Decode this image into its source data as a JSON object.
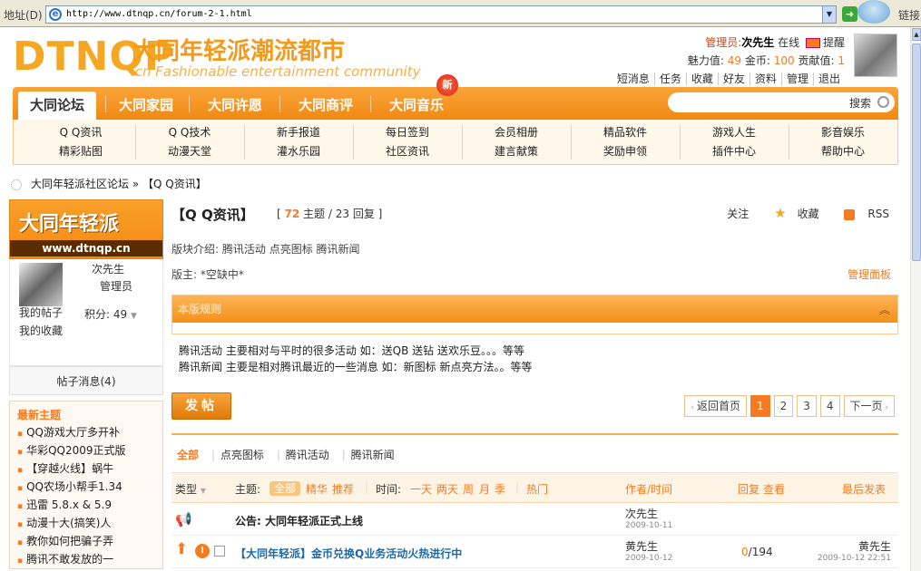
{
  "browser": {
    "address_label": "地址(D)",
    "url": "http://www.dtnqp.cn/forum-2-1.html",
    "links_label": "链接"
  },
  "header": {
    "logo_big": "DTNQP",
    "logo_cn": "大同年轻派潮流都市",
    "logo_en": ".cn Fashionable entertainment community",
    "role": "管理员:",
    "username": "次先生",
    "online": "在线",
    "remind": "提醒",
    "charm_label": "魅力值:",
    "charm": "49",
    "gold_label": "金币:",
    "gold": "100",
    "contrib_label": "贡献值:",
    "contrib": "1",
    "links": [
      "短消息",
      "任务",
      "收藏",
      "好友",
      "资料",
      "管理",
      "退出"
    ]
  },
  "nav": {
    "tabs": [
      "大同论坛",
      "大同家园",
      "大同许愿",
      "大同商评",
      "大同音乐"
    ],
    "new_badge": "新",
    "search_label": "搜索"
  },
  "subnav": {
    "row1": [
      "Q Q资讯",
      "Q Q技术",
      "新手报道",
      "每日签到",
      "会员相册",
      "精品软件",
      "游戏人生",
      "影音娱乐"
    ],
    "row2": [
      "精彩贴图",
      "动漫天堂",
      "灌水乐园",
      "社区资讯",
      "建言献策",
      "奖励申领",
      "插件中心",
      "帮助中心"
    ]
  },
  "breadcrumb": {
    "home": "大同年轻派社区论坛",
    "sep": "»",
    "current": "【Q Q资讯】"
  },
  "sidebar": {
    "banner_title": "大同年轻派",
    "banner_url": "www.dtnqp.cn",
    "name": "次先生",
    "role": "管理员",
    "my_posts": "我的帖子",
    "my_favs": "我的收藏",
    "points": "积分: 49",
    "messages": "帖子消息(4)",
    "latest_title": "最新主题",
    "latest": [
      "QQ游戏大厅多开补",
      "华彩QQ2009正式版",
      "【穿越火线】蜗牛",
      "QQ农场小帮手1.34",
      "迅雷 5.8.x & 5.9",
      "动漫十大(搞笑)人",
      "教你如何把骗子弄",
      "腾讯不敢发放的一"
    ]
  },
  "forum": {
    "title": "【Q Q资讯】",
    "stat_open": "[",
    "topics": "72",
    "topics_label": "主题 /",
    "replies": "23",
    "replies_label": "回复 ]",
    "follow": "关注",
    "fav": "收藏",
    "rss": "RSS",
    "intro_label": "版块介绍:",
    "intro": "腾讯活动 点亮图标 腾讯新闻",
    "mod": "版主: *空缺中*",
    "panel": "管理面板",
    "rules_title": "本版规则",
    "rules": [
      "腾讯活动 主要相对与平时的很多活动 如：送QB 送钻 送欢乐豆。。。等等",
      "腾讯新闻 主要是相对腾讯最近的一些消息 如：新图标 新点亮方法。。等等"
    ],
    "post_btn": "发帖",
    "pager": {
      "back": "返回首页",
      "pages": [
        "1",
        "2",
        "3",
        "4"
      ],
      "next": "下一页"
    },
    "types": [
      "全部",
      "点亮图标",
      "腾讯活动",
      "腾讯新闻"
    ],
    "head": {
      "type": "类型",
      "topic": "主题:",
      "all": "全部",
      "digest": "精华",
      "recommend": "推荐",
      "time": "时间:",
      "times": [
        "一天",
        "两天",
        "周",
        "月",
        "季"
      ],
      "hot": "热门",
      "author": "作者/时间",
      "replies": "回复",
      "views": "查看",
      "last": "最后发表"
    },
    "threads": [
      {
        "title": "公告: 大同年轻派正式上线",
        "author": "次先生",
        "date": "2009-10-11",
        "reply": "",
        "view": "",
        "last_user": "",
        "last_date": ""
      },
      {
        "title": "【大同年轻派】金币兑换Q业务活动火热进行中",
        "author": "黄先生",
        "date": "2009-10-12",
        "reply": "0",
        "view": "194",
        "last_user": "黄先生",
        "last_date": "2009-10-12 22:51"
      }
    ]
  },
  "colors": {
    "accent": "#f57b20",
    "nav": "#f39119",
    "link_blue": "#1a6aa8"
  }
}
